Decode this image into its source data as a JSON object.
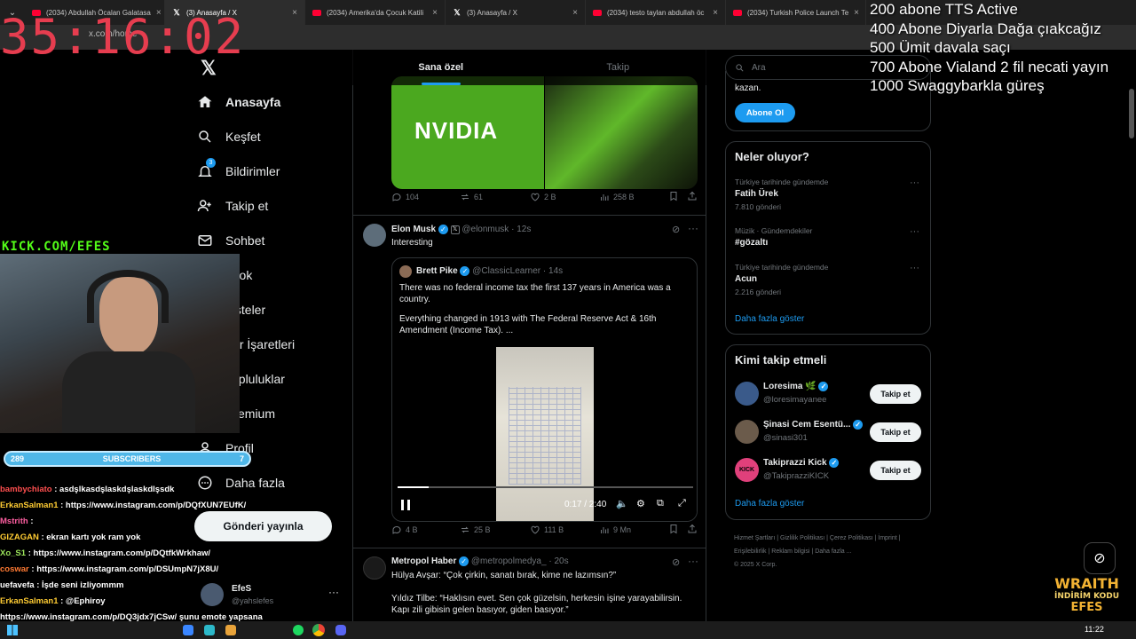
{
  "browser": {
    "tabs": [
      {
        "title": "(2034) Abdullah Öcalan Galatasa",
        "kind": "youtube"
      },
      {
        "title": "(3) Anasayfa / X",
        "kind": "x"
      },
      {
        "title": "(2034) Amerika'da Çocuk Katili",
        "kind": "youtube"
      },
      {
        "title": "(3) Anasayfa / X",
        "kind": "x"
      },
      {
        "title": "(2034) testo taylan abdullah öc",
        "kind": "youtube"
      },
      {
        "title": "(2034) Turkish Police Launch Te",
        "kind": "youtube"
      }
    ],
    "url": "x.com/home"
  },
  "stream": {
    "timer": "35:16:02",
    "goals": [
      "200 abone TTS Active",
      "400 Abone Diyarla Dağa çıakcağız",
      "500 Ümit davala saçı",
      "700 Abone Vialand 2 fil necati yayın",
      "1000 Swaggybarkla güreş"
    ],
    "kick_handle": "KICK.COM/EFES",
    "subs_current": "289",
    "subs_label": "SUBSCRIBERS",
    "subs_target": "7",
    "chat": [
      {
        "user": "bambychiato",
        "text": ": asdşlkasdşlaskdşlaskdlşsdk",
        "color": "#ff4f4f"
      },
      {
        "user": "ErkanSalman1",
        "text": ": https://www.instagram.com/p/DQfXUN7EUfK/",
        "color": "#ffcc33"
      },
      {
        "user": "Mstrith",
        "text": ":",
        "color": "#ff5fa2"
      },
      {
        "user": "GIZAGAN",
        "text": ": ekran kartı yok ram yok",
        "color": "#ffcc33"
      },
      {
        "user": "Xo_S1",
        "text": ": https://www.instagram.com/p/DQtfkWrkhaw/",
        "color": "#9be35b"
      },
      {
        "user": "coswar",
        "text": ": https://www.instagram.com/p/DSUmpN7jX8U/",
        "color": "#ff7a33"
      },
      {
        "user": "uefavefa",
        "text": ": İşde seni izliyommm",
        "color": "#ffffff"
      },
      {
        "user": "ErkanSalman1",
        "text": ": @Ephiroy",
        "color": "#ffcc33"
      },
      {
        "user": "",
        "text": "https://www.instagram.com/p/DQ3jdx7jCSw/ şunu emote yapsana",
        "color": "#ffffff"
      }
    ],
    "brand": "WRAITH",
    "brand_sub": "İNDİRİM KODU",
    "brand_code": "EFES"
  },
  "nav": {
    "items": [
      {
        "label": "Anasayfa",
        "icon": "home-icon"
      },
      {
        "label": "Keşfet",
        "icon": "search-icon"
      },
      {
        "label": "Bildirimler",
        "icon": "bell-icon",
        "badge": "3"
      },
      {
        "label": "Takip et",
        "icon": "person-add-icon"
      },
      {
        "label": "Sohbet",
        "icon": "mail-icon"
      },
      {
        "label": "Grok",
        "icon": "grok-icon"
      },
      {
        "label": "Listeler",
        "icon": "list-icon"
      },
      {
        "label": "Yer İşaretleri",
        "icon": "bookmark-icon"
      },
      {
        "label": "Topluluklar",
        "icon": "community-icon"
      },
      {
        "label": "Premium",
        "icon": "x-icon"
      },
      {
        "label": "Profil",
        "icon": "profile-icon"
      },
      {
        "label": "Daha fazla",
        "icon": "more-icon"
      }
    ],
    "post_button": "Gönderi yayınla",
    "account_name": "EfeS",
    "account_handle": "@yahslefes"
  },
  "timeline": {
    "tabs": [
      "Sana özel",
      "Takip"
    ],
    "first_post_actions": {
      "replies": "104",
      "reposts": "61",
      "likes": "2 B",
      "views": "258 B"
    },
    "nvidia_text": "NVIDIA",
    "post2": {
      "name": "Elon Musk",
      "handle": "@elonmusk",
      "time": "12s",
      "text": "Interesting",
      "quote": {
        "name": "Brett Pike",
        "handle": "@ClassicLearner",
        "time": "14s",
        "text1": "There was no federal income tax the first 137 years in America was a country.",
        "text2": "Everything changed in 1913 with The Federal Reserve Act & 16th Amendment (Income Tax). ...",
        "video_time": "0:17 / 2:40",
        "video_progress": 0.106
      },
      "actions": {
        "replies": "4 B",
        "reposts": "25 B",
        "likes": "111 B",
        "views": "9 Mn"
      }
    },
    "post3": {
      "name": "Metropol Haber",
      "handle": "@metropolmedya_",
      "time": "20s",
      "line1": "Hülya Avşar: “Çok çirkin, sanatı bırak, kime ne lazımsın?”",
      "line2": "Yıldız Tilbe: “Haklısın evet. Sen çok güzelsin, herkesin işine yarayabilirsin. Kapı zili gibisin gelen basıyor, giden basıyor.”"
    }
  },
  "sidebar": {
    "search_placeholder": "Ara",
    "premium_text": "kazan.",
    "premium_button": "Abone Ol",
    "trends_title": "Neler oluyor?",
    "trends": [
      {
        "context": "Türkiye tarihinde gündemde",
        "title": "Fatih Ürek",
        "count": "7.810 gönderi"
      },
      {
        "context": "Müzik · Gündemdekiler",
        "title": "#gözaltı",
        "count": ""
      },
      {
        "context": "Türkiye tarihinde gündemde",
        "title": "Acun",
        "count": "2.216 gönderi"
      }
    ],
    "trends_more": "Daha fazla göster",
    "who_title": "Kimi takip etmeli",
    "who": [
      {
        "name": "Loresima 🌿",
        "handle": "@loresimayanee",
        "button": "Takip et",
        "avatar_color": "#3a5a8a"
      },
      {
        "name": "Şinasi Cem Esentü...",
        "handle": "@sinasi301",
        "button": "Takip et",
        "avatar_color": "#6b5b4b"
      },
      {
        "name": "Takiprazzi Kick",
        "handle": "@TakiprazziKICK",
        "button": "Takip et",
        "avatar_color": "#e0407b"
      }
    ],
    "who_more": "Daha fazla göster",
    "footer": [
      "Hizmet Şartları",
      "Gizlilik Politikası",
      "Çerez Politikası",
      "İmprint",
      "Erişilebilirlik",
      "Reklam bilgisi",
      "Daha fazla ...",
      "© 2025 X Corp."
    ]
  },
  "taskbar": {
    "time": "11:22"
  }
}
